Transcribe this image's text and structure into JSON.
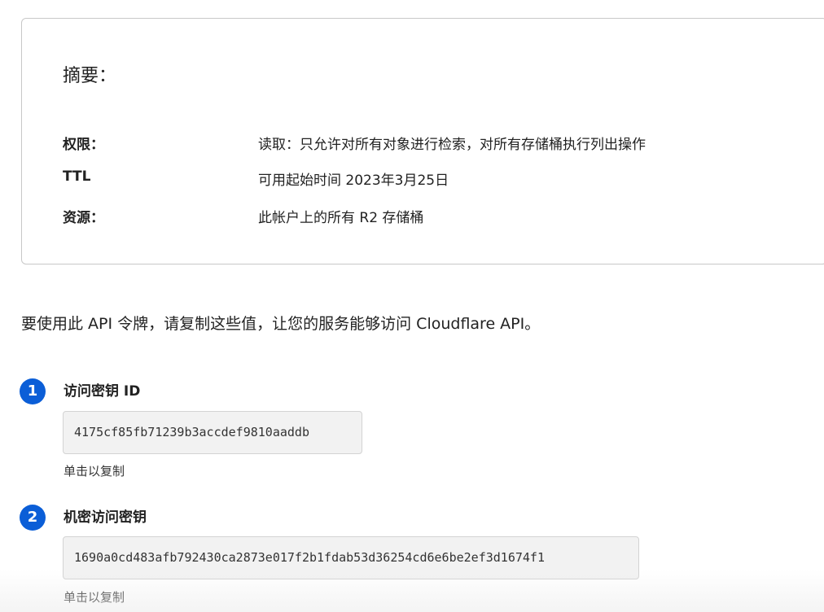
{
  "summary": {
    "title": "摘要：",
    "rows": [
      {
        "key": "权限：",
        "value": "读取：只允许对所有对象进行检索，对所有存储桶执行列出操作"
      },
      {
        "key": "TTL",
        "value": "可用起始时间 2023年3月25日"
      },
      {
        "key": "资源：",
        "value": "此帐户上的所有 R2 存储桶"
      }
    ]
  },
  "intro": "要使用此 API 令牌，请复制这些值，让您的服务能够访问 Cloudflare API。",
  "steps": [
    {
      "number": "1",
      "title": "访问密钥 ID",
      "value": "4175cf85fb71239b3accdef9810aaddb",
      "hint": "单击以复制"
    },
    {
      "number": "2",
      "title": "机密访问密钥",
      "value": "1690a0cd483afb792430ca2873e017f2b1fdab53d36254cd6e6be2ef3d1674f1",
      "hint": "单击以复制"
    }
  ],
  "colors": {
    "badge": "#0b5ed7",
    "copy_box_bg": "#f2f2f2",
    "card_border": "#c8c8c8"
  }
}
